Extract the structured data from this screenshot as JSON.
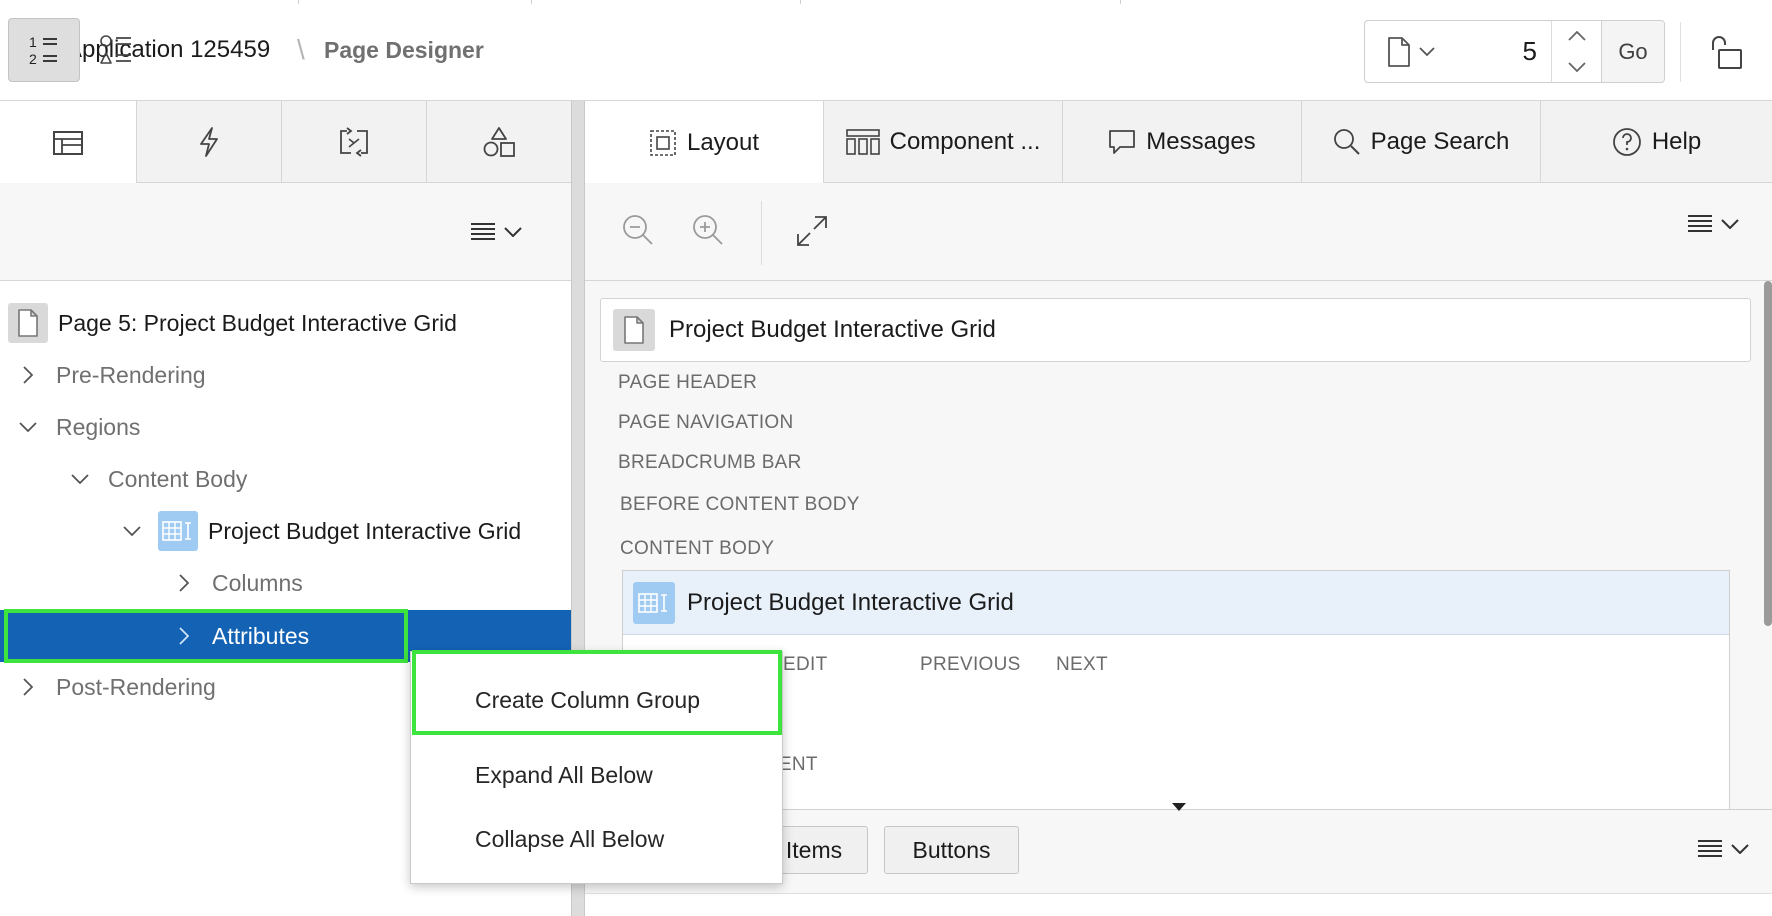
{
  "header": {
    "app_title": "Application 125459",
    "separator": "\\",
    "page_designer": "Page Designer",
    "page_number": "5",
    "go_label": "Go"
  },
  "left_panel": {
    "tabs": [
      "rendering",
      "dynamic-actions",
      "processing",
      "shared-components"
    ],
    "active_tab": "rendering",
    "view_buttons": [
      "tree-view",
      "component-view"
    ],
    "tree": {
      "page": "Page 5: Project Budget Interactive Grid",
      "pre_rendering": "Pre-Rendering",
      "regions": "Regions",
      "content_body": "Content Body",
      "ig": "Project Budget Interactive Grid",
      "columns": "Columns",
      "attributes": "Attributes",
      "post_rendering": "Post-Rendering"
    }
  },
  "right_panel": {
    "tabs": [
      {
        "label": "Layout",
        "icon": "layout-icon"
      },
      {
        "label": "Component ...",
        "icon": "component-view-icon"
      },
      {
        "label": "Messages",
        "icon": "messages-icon"
      },
      {
        "label": "Page Search",
        "icon": "search-icon"
      },
      {
        "label": "Help",
        "icon": "help-icon"
      }
    ],
    "active_tab": "Layout",
    "page_card_title": "Project Budget Interactive Grid",
    "positions": {
      "page_header": "PAGE HEADER",
      "page_navigation": "PAGE NAVIGATION",
      "breadcrumb_bar": "BREADCRUMB BAR",
      "before_content_body": "BEFORE CONTENT BODY",
      "content_body": "CONTENT BODY"
    },
    "ig_region_title": "Project Budget Interactive Grid",
    "ig_sub": {
      "edit": "EDIT",
      "previous": "PREVIOUS",
      "next": "NEXT",
      "tent": "TENT"
    },
    "gallery_buttons": {
      "items": "Items",
      "buttons": "Buttons"
    }
  },
  "context_menu": {
    "items": [
      "Create Column Group",
      "Expand All Below",
      "Collapse All Below"
    ],
    "highlighted": "Create Column Group"
  },
  "colors": {
    "selected_row": "#1362b4",
    "highlight_box": "#3ee43e",
    "accent": "#1a6fc4"
  }
}
